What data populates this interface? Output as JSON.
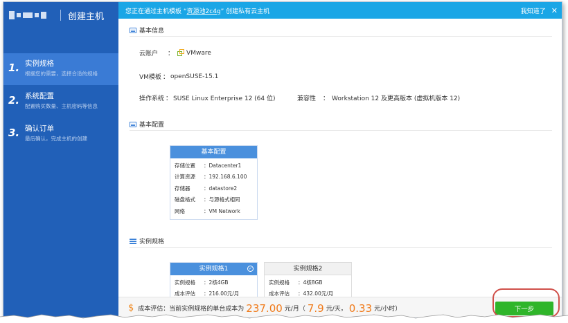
{
  "sidebar": {
    "title": "创建主机",
    "steps": [
      {
        "num": "1.",
        "title": "实例规格",
        "desc": "根据您的需要，选择合适的规格"
      },
      {
        "num": "2.",
        "title": "系统配置",
        "desc": "配置购买数量、主机密码等信息"
      },
      {
        "num": "3.",
        "title": "确认订单",
        "desc": "最后确认，完成主机的创建"
      }
    ]
  },
  "banner": {
    "prefix": "您正在通过主机模板 “",
    "template_name": "资源池2c4g",
    "suffix": "” 创建私有云主机",
    "dismiss": "我知道了",
    "close": "✕"
  },
  "basic_info": {
    "heading": "基本信息",
    "account_label": "云账户",
    "account_value": "VMware",
    "template_label": "VM模板",
    "template_value": "openSUSE-15.1",
    "os_label": "操作系统",
    "os_value": "SUSE Linux Enterprise 12 (64 位)",
    "compat_label": "兼容性",
    "compat_value": "Workstation 12 及更高版本 (虚拟机版本 12)"
  },
  "basic_config": {
    "heading": "基本配置",
    "card_title": "基本配置",
    "rows": [
      {
        "k": "存储位置",
        "v": "Datacenter1"
      },
      {
        "k": "计算资源",
        "v": "192.168.6.100"
      },
      {
        "k": "存储器",
        "v": "datastore2"
      },
      {
        "k": "磁盘格式",
        "v": "与源格式相同"
      },
      {
        "k": "网络",
        "v": "VM Network"
      }
    ]
  },
  "instance_spec": {
    "heading": "实例规格",
    "cards": [
      {
        "title": "实例规格1",
        "selected": true,
        "rows": [
          {
            "k": "实例规格",
            "v": "2核4GB"
          },
          {
            "k": "成本评估",
            "v": "216.00元/月"
          }
        ]
      },
      {
        "title": "实例规格2",
        "selected": false,
        "rows": [
          {
            "k": "实例规格",
            "v": "4核8GB"
          },
          {
            "k": "成本评估",
            "v": "432.00元/月"
          }
        ]
      }
    ]
  },
  "footer": {
    "label": "成本评估：当前实例规格的单台成本为",
    "monthly": "237.00",
    "monthly_unit": "元/月（",
    "daily": "7.9",
    "daily_unit": "元/天，",
    "hourly": "0.33",
    "hourly_unit": "元/小时）",
    "next_label": "下一步"
  },
  "colors": {
    "sidebar": "#2160b8",
    "banner": "#1aa6e6",
    "accent_orange": "#f07a1a",
    "next_green": "#2fb52a"
  }
}
